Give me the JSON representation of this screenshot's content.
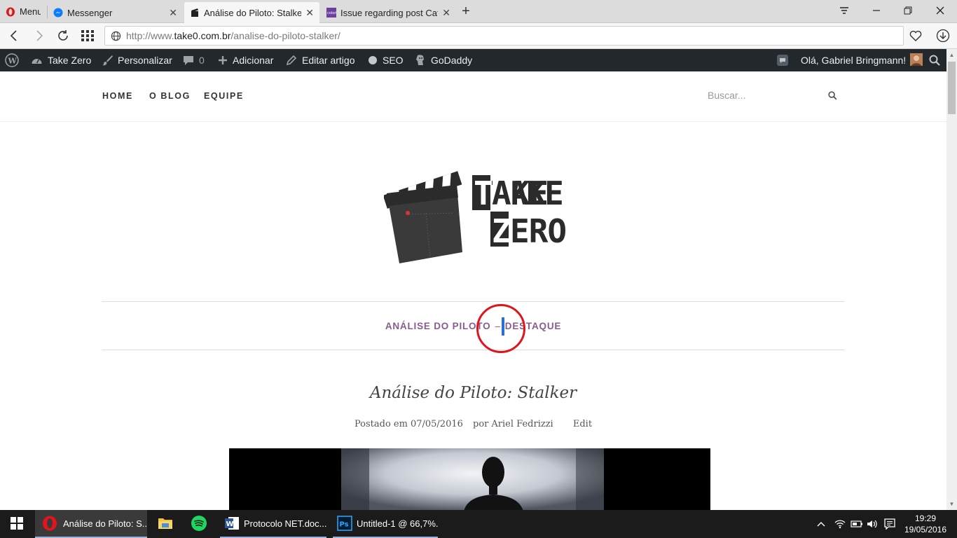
{
  "browser": {
    "menu_label": "Menu",
    "tabs": [
      {
        "label": "Messenger",
        "icon": "messenger-icon"
      },
      {
        "label": "Análise do Piloto: Stalker –",
        "icon": "clapperboard-icon"
      },
      {
        "label": "Issue regarding post Categ",
        "icon": "colorlib-icon"
      }
    ],
    "url_prefix": "http://www.",
    "url_domain": "take0.com.br",
    "url_path": "/analise-do-piloto-stalker/"
  },
  "wp_admin": {
    "site_name": "Take Zero",
    "customize": "Personalizar",
    "comments_count": "0",
    "add_new": "Adicionar",
    "edit_post": "Editar artigo",
    "seo": "SEO",
    "godaddy": "GoDaddy",
    "greeting": "Olá, Gabriel Bringmann!"
  },
  "site": {
    "nav": [
      "HOME",
      "O BLOG",
      "EQUIPE"
    ],
    "search_placeholder": "Buscar...",
    "logo_text_top": "TAKE",
    "logo_text_bottom": "ZERO",
    "categories": [
      "ANÁLISE DO PILOTO",
      "DESTAQUE"
    ],
    "category_separator": "–",
    "post_title": "Análise do Piloto: Stalker",
    "posted_on_label": "Postado em",
    "post_date": "07/05/2016",
    "by_label": "por",
    "author": "Ariel Fedrizzi",
    "edit_label": "Edit"
  },
  "taskbar": {
    "items": [
      {
        "label": "Análise do Piloto: S...",
        "icon": "opera-icon"
      },
      {
        "label": "",
        "icon": "file-explorer-icon"
      },
      {
        "label": "",
        "icon": "spotify-icon"
      },
      {
        "label": "Protocolo NET.doc...",
        "icon": "word-icon"
      },
      {
        "label": "Untitled-1 @ 66,7%...",
        "icon": "photoshop-icon"
      }
    ],
    "time": "19:29",
    "date": "19/05/2016"
  },
  "colors": {
    "wp_admin_bg": "#23282d",
    "category_purple": "#8a5a92",
    "highlight_circle": "#e0141b",
    "caret_blue": "#2a6fd6"
  }
}
